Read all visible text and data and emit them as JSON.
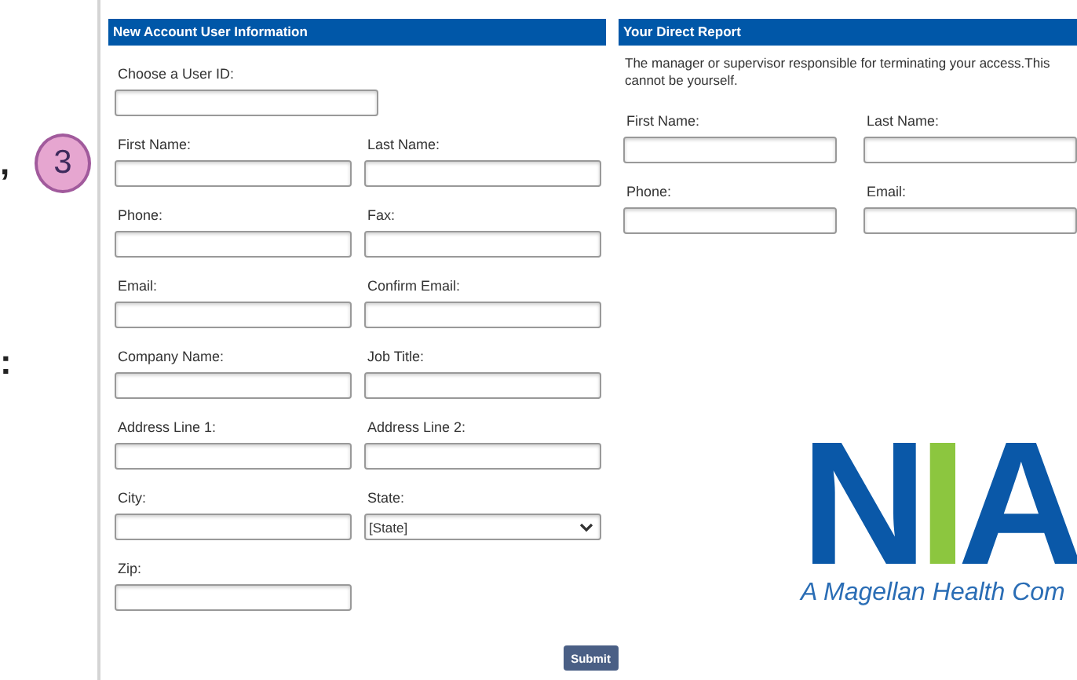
{
  "slide_edge": {
    "marks": [
      ",",
      ":"
    ],
    "step_badge": "3"
  },
  "account_panel": {
    "title": "New Account User Information",
    "rows": [
      [
        {
          "label": "Choose a User ID:",
          "kind": "text"
        }
      ],
      [
        {
          "label": "First Name:",
          "kind": "text"
        },
        {
          "label": "Last Name:",
          "kind": "text"
        }
      ],
      [
        {
          "label": "Phone:",
          "kind": "text"
        },
        {
          "label": "Fax:",
          "kind": "text"
        }
      ],
      [
        {
          "label": "Email:",
          "kind": "text"
        },
        {
          "label": "Confirm Email:",
          "kind": "text"
        }
      ],
      [
        {
          "label": "Company Name:",
          "kind": "text"
        },
        {
          "label": "Job Title:",
          "kind": "text"
        }
      ],
      [
        {
          "label": "Address Line 1:",
          "kind": "text"
        },
        {
          "label": "Address Line 2:",
          "kind": "text"
        }
      ],
      [
        {
          "label": "City:",
          "kind": "text"
        },
        {
          "label": "State:",
          "kind": "select",
          "value": "[State]"
        }
      ],
      [
        {
          "label": "Zip:",
          "kind": "text"
        }
      ]
    ],
    "submit": "Submit"
  },
  "report_panel": {
    "title": "Your Direct Report",
    "description": "The manager or supervisor responsible for terminating your access.This cannot be yourself.",
    "rows": [
      [
        {
          "label": "First Name:",
          "kind": "text"
        },
        {
          "label": "Last Name:",
          "kind": "text"
        }
      ],
      [
        {
          "label": "Phone:",
          "kind": "text"
        },
        {
          "label": "Email:",
          "kind": "text"
        }
      ]
    ]
  },
  "logo": {
    "letters": [
      "N",
      "I",
      "A"
    ],
    "tagline": "A Magellan Health Com"
  }
}
